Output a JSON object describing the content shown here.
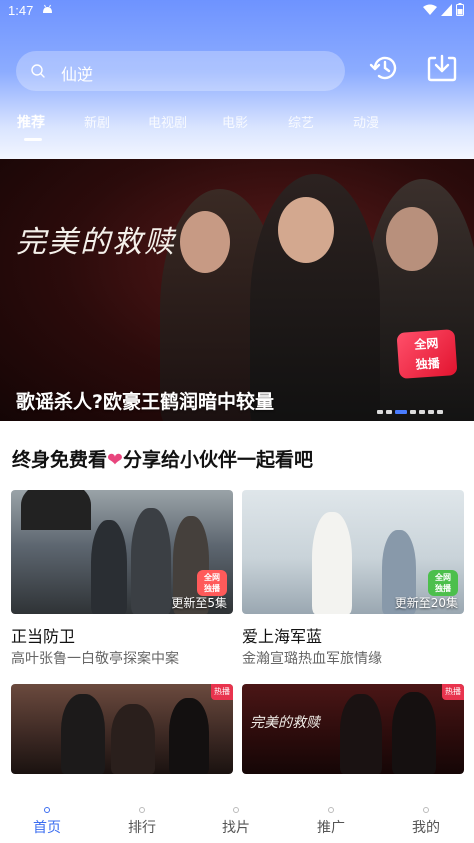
{
  "status_bar": {
    "time": "1:47"
  },
  "search": {
    "text": "仙逆"
  },
  "tabs": [
    {
      "label": "推荐"
    },
    {
      "label": "新剧"
    },
    {
      "label": "电视剧"
    },
    {
      "label": "电影"
    },
    {
      "label": "综艺"
    },
    {
      "label": "动漫"
    }
  ],
  "banner": {
    "logo_text": "完美的救赎",
    "badge_line1": "全网",
    "badge_line2": "独播",
    "title": "歌谣杀人?欧豪王鹤润暗中较量",
    "active_dot": 2,
    "dot_count": 7
  },
  "section": {
    "title_part1": "终身免费看",
    "heart": "❤",
    "title_part2": "分享给小伙伴一起看吧"
  },
  "cards": [
    {
      "title": "正当防卫",
      "subtitle": "高叶张鲁一白敬亭探案中案",
      "update": "更新至5集",
      "badge_line1": "全网",
      "badge_line2": "独播",
      "badge_color": "#ff5a5a"
    },
    {
      "title": "爱上海军蓝",
      "subtitle": "金瀚宣璐热血军旅情缘",
      "update": "更新至20集",
      "badge_line1": "全网",
      "badge_line2": "独播",
      "badge_color": "#4cbf4c"
    },
    {
      "title": "",
      "subtitle": "",
      "update": "",
      "hot": "热播"
    },
    {
      "title": "",
      "subtitle": "",
      "update": "",
      "hot": "热播",
      "logo_text": "完美的救赎"
    }
  ],
  "tabbar": [
    {
      "label": "首页",
      "active": true
    },
    {
      "label": "排行"
    },
    {
      "label": "找片"
    },
    {
      "label": "推广"
    },
    {
      "label": "我的"
    }
  ],
  "colors": {
    "accent": "#3b6df0",
    "header_top": "#6e93ff",
    "heart": "#e8457d"
  }
}
